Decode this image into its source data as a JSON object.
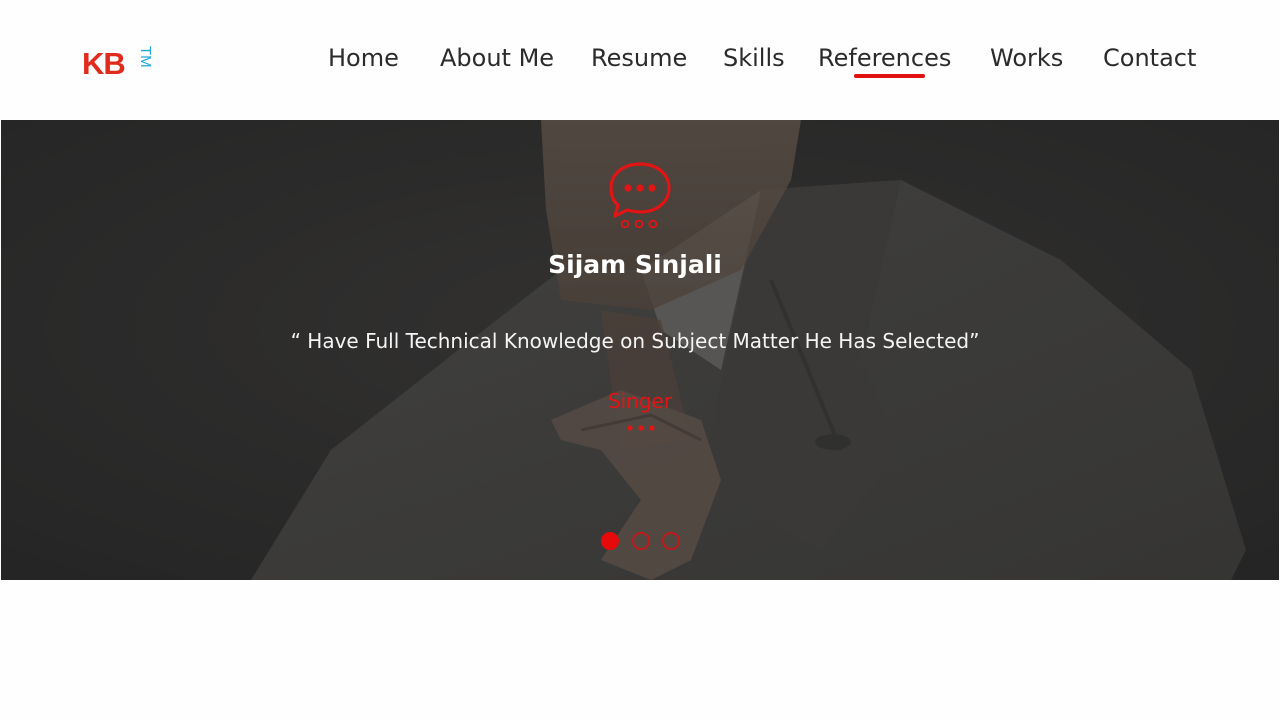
{
  "brand": {
    "logo_text": "KB",
    "logo_mark": "TM",
    "primary_color": "#e02a1c",
    "mark_color": "#1ea7d8"
  },
  "nav": {
    "items": [
      {
        "label": "Home"
      },
      {
        "label": "About Me"
      },
      {
        "label": "Resume"
      },
      {
        "label": "Skills"
      },
      {
        "label": "References",
        "active": true
      },
      {
        "label": "Works"
      },
      {
        "label": "Contact"
      }
    ],
    "active_color": "#e01010"
  },
  "testimonial": {
    "icon": "speech-bubble-icon",
    "name": "Sijam Sinjali",
    "quote": "“ Have Full Technical Knowledge on Subject Matter He Has Selected”",
    "role": "Singer",
    "accent_color": "#e21414"
  },
  "carousel": {
    "slide_count": 3,
    "active_index": 0
  }
}
